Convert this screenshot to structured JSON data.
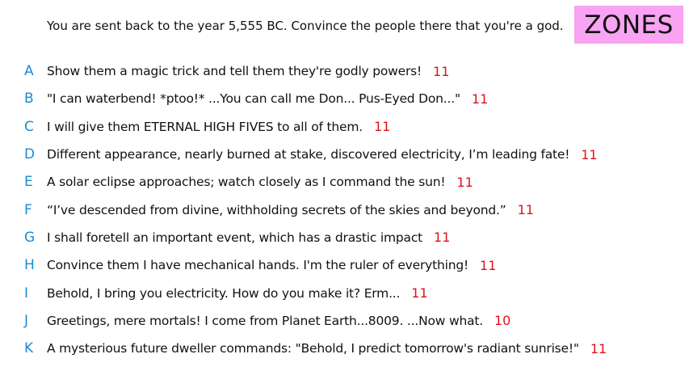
{
  "header": {
    "prompt": "You are sent back to the year 5,555 BC. Convince the people there that you're a god.",
    "badge": "ZONES"
  },
  "colors": {
    "letter": "#1a8bd6",
    "score": "#e1101b",
    "badge_bg": "#f9a3f3",
    "text": "#111111"
  },
  "answers": [
    {
      "letter": "A",
      "text": "Show them a magic trick and tell them they're godly powers!",
      "score": "11"
    },
    {
      "letter": "B",
      "text": "\"I can waterbend! *ptoo!* ...You can call me Don... Pus-Eyed Don...\"",
      "score": "11"
    },
    {
      "letter": "C",
      "text": "I will give them ETERNAL HIGH FIVES to all of them.",
      "score": "11"
    },
    {
      "letter": "D",
      "text": "Different appearance, nearly burned at stake, discovered electricity, I’m leading fate!",
      "score": "11"
    },
    {
      "letter": "E",
      "text": "A solar eclipse approaches; watch closely as I command the sun!",
      "score": "11"
    },
    {
      "letter": "F",
      "text": "“I’ve descended from divine, withholding secrets of the skies and beyond.”",
      "score": "11"
    },
    {
      "letter": "G",
      "text": "I shall foretell an important event, which has a drastic impact",
      "score": "11"
    },
    {
      "letter": "H",
      "text": "Convince them I have mechanical hands. I'm the ruler of everything!",
      "score": "11"
    },
    {
      "letter": "I",
      "text": "Behold, I bring you electricity. How do you make it? Erm...",
      "score": "11"
    },
    {
      "letter": "J",
      "text": "Greetings, mere mortals! I come from Planet Earth...8009. ...Now what.",
      "score": "10"
    },
    {
      "letter": "K",
      "text": "A mysterious future dweller commands: \"Behold, I predict tomorrow's radiant sunrise!\"",
      "score": "11"
    }
  ]
}
